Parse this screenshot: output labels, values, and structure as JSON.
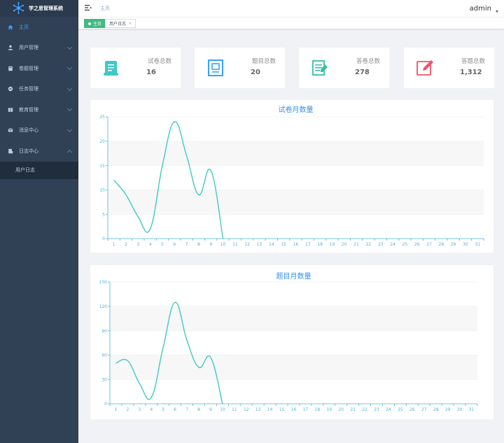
{
  "app": {
    "title": "学之思管理系统"
  },
  "sidebar": {
    "items": [
      {
        "label": "主页",
        "icon": "home-icon",
        "active": true
      },
      {
        "label": "用户管理",
        "icon": "user-icon"
      },
      {
        "label": "卷题管理",
        "icon": "book-icon"
      },
      {
        "label": "任务管理",
        "icon": "task-icon"
      },
      {
        "label": "教育管理",
        "icon": "education-icon"
      },
      {
        "label": "消息中心",
        "icon": "message-icon"
      },
      {
        "label": "日志中心",
        "icon": "log-icon",
        "expanded": true
      }
    ],
    "submenu": [
      {
        "label": "用户日志"
      }
    ]
  },
  "header": {
    "breadcrumb": "主页",
    "user": "admin"
  },
  "tags": [
    {
      "label": "主页",
      "active": true
    },
    {
      "label": "用户日志"
    }
  ],
  "stats": [
    {
      "label": "试卷总数",
      "value": "16",
      "icon": "paper-scroll-icon",
      "color": "#40c9c6"
    },
    {
      "label": "题目总数",
      "value": "20",
      "icon": "question-book-icon",
      "color": "#36a3f7"
    },
    {
      "label": "答卷总数",
      "value": "278",
      "icon": "answer-sheet-icon",
      "color": "#34bfa3"
    },
    {
      "label": "答题总数",
      "value": "1,312",
      "icon": "edit-icon",
      "color": "#f4516c"
    }
  ],
  "colors": {
    "line": "#40c9c6",
    "axis": "#4fb3d9",
    "title": "#3a8ee6",
    "sidebar": "#304156",
    "active": "#409eff"
  },
  "chart_data": [
    {
      "type": "line",
      "title": "试卷月数量",
      "x": [
        1,
        2,
        3,
        4,
        5,
        6,
        7,
        8,
        9,
        10,
        11,
        12,
        13,
        14,
        15,
        16,
        17,
        18,
        19,
        20,
        21,
        22,
        23,
        24,
        25,
        26,
        27,
        28,
        29,
        30,
        31
      ],
      "values": [
        12,
        9,
        4.5,
        2,
        15,
        24,
        17,
        9,
        14,
        0
      ],
      "ylim": [
        0,
        25
      ],
      "yticks": [
        0,
        5,
        10,
        15,
        20,
        25
      ],
      "grid": "horizontal-bands",
      "smooth": true
    },
    {
      "type": "line",
      "title": "题目月数量",
      "x": [
        1,
        2,
        3,
        4,
        5,
        6,
        7,
        8,
        9,
        10,
        11,
        12,
        13,
        14,
        15,
        16,
        17,
        18,
        19,
        20,
        21,
        22,
        23,
        24,
        25,
        26,
        27,
        28,
        29,
        30,
        31
      ],
      "values": [
        50,
        53,
        25,
        8,
        70,
        125,
        78,
        45,
        57,
        0
      ],
      "ylim": [
        0,
        150
      ],
      "yticks": [
        0,
        30,
        60,
        90,
        120,
        150
      ],
      "grid": "horizontal-bands",
      "smooth": true
    }
  ]
}
